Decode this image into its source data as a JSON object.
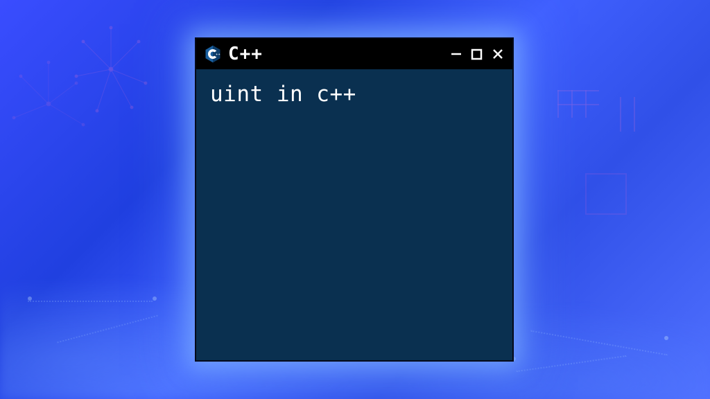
{
  "window": {
    "title": "C++",
    "icon_name": "cpp-logo-icon"
  },
  "content": {
    "code": "uint in c++"
  },
  "colors": {
    "window_bg": "#0a3050",
    "titlebar_bg": "#000000",
    "text": "#ffffff"
  }
}
